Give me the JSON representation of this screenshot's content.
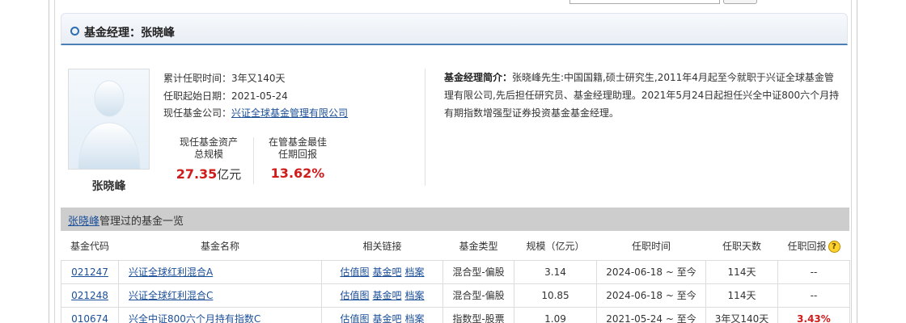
{
  "section": {
    "title": "基金经理：张晓峰"
  },
  "manager": {
    "name": "张晓峰",
    "tenure_label": "累计任职时间：",
    "tenure_value": "3年又140天",
    "start_label": "任职起始日期：",
    "start_value": "2021-05-24",
    "company_label": "现任基金公司：",
    "company_value": "兴证全球基金管理有限公司",
    "stats": [
      {
        "label_line1": "现任基金资产",
        "label_line2": "总规模",
        "value": "27.35",
        "unit": "亿元"
      },
      {
        "label_line1": "在管基金最佳",
        "label_line2": "任期回报",
        "value": "13.62%",
        "unit": ""
      }
    ],
    "intro_label": "基金经理简介：",
    "intro_text": "张晓峰先生:中国国籍,硕士研究生,2011年4月起至今就职于兴证全球基金管理有限公司,先后担任研究员、基金经理助理。2021年5月24日起担任兴全中证800六个月持有期指数增强型证券投资基金基金经理。"
  },
  "fund_list": {
    "title_link": "张晓峰",
    "title_rest": "管理过的基金一览",
    "headers": [
      "基金代码",
      "基金名称",
      "相关链接",
      "基金类型",
      "规模（亿元）",
      "任职时间",
      "任职天数",
      "任职回报"
    ],
    "help_icon": "question-icon",
    "rows": [
      {
        "code": "021247",
        "name": "兴证全球红利混合A",
        "links": [
          "估值图",
          "基金吧",
          "档案"
        ],
        "type": "混合型-偏股",
        "size": "3.14",
        "period": "2024-06-18 ~ 至今",
        "days": "114天",
        "return": "--",
        "return_color": "#333333"
      },
      {
        "code": "021248",
        "name": "兴证全球红利混合C",
        "links": [
          "估值图",
          "基金吧",
          "档案"
        ],
        "type": "混合型-偏股",
        "size": "10.85",
        "period": "2024-06-18 ~ 至今",
        "days": "114天",
        "return": "--",
        "return_color": "#333333"
      },
      {
        "code": "010674",
        "name": "兴全中证800六个月持有指数C",
        "links": [
          "估值图",
          "基金吧",
          "档案"
        ],
        "type": "指数型-股票",
        "size": "1.09",
        "period": "2021-05-24 ~ 至今",
        "days": "3年又140天",
        "return": "3.43%",
        "return_color": "#d01b1b"
      }
    ]
  },
  "colors": {
    "accent": "#2d6db1",
    "link": "#1b4f98",
    "positive": "#d01b1b"
  }
}
